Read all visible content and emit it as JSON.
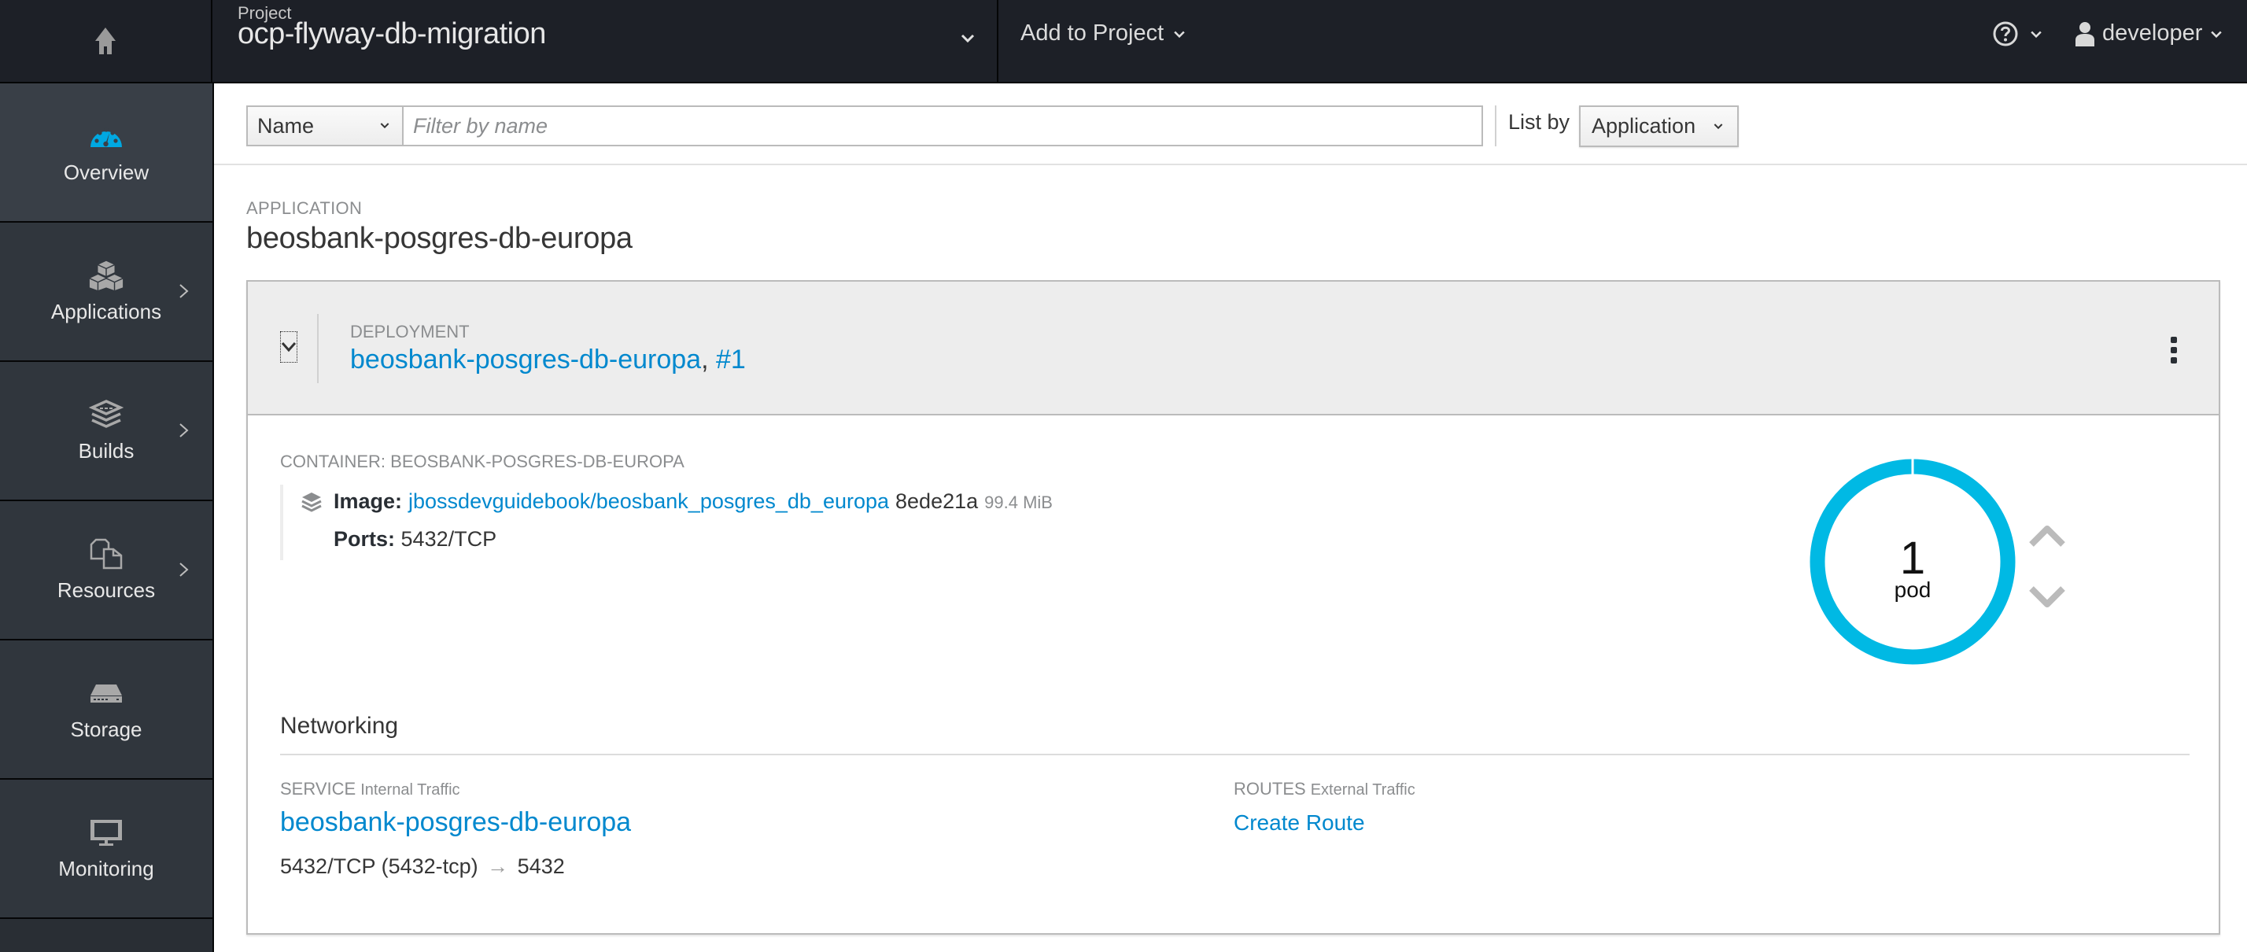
{
  "header": {
    "home_icon": "home-icon",
    "project_label": "Project",
    "project_name": "ocp-flyway-db-migration",
    "add_to_project": "Add to Project",
    "help_icon": "question-circle-icon",
    "user_icon": "user-icon",
    "username": "developer"
  },
  "sidebar": {
    "items": [
      {
        "label": "Overview",
        "icon": "dashboard-icon",
        "active": true,
        "has_submenu": false
      },
      {
        "label": "Applications",
        "icon": "cubes-icon",
        "active": false,
        "has_submenu": true
      },
      {
        "label": "Builds",
        "icon": "layers-icon",
        "active": false,
        "has_submenu": true
      },
      {
        "label": "Resources",
        "icon": "files-icon",
        "active": false,
        "has_submenu": true
      },
      {
        "label": "Storage",
        "icon": "storage-icon",
        "active": false,
        "has_submenu": false
      },
      {
        "label": "Monitoring",
        "icon": "monitor-icon",
        "active": false,
        "has_submenu": false
      }
    ]
  },
  "toolbar": {
    "filter_type": "Name",
    "filter_placeholder": "Filter by name",
    "filter_value": "",
    "list_by_label": "List by",
    "list_by_value": "Application"
  },
  "application": {
    "kicker": "APPLICATION",
    "name": "beosbank-posgres-db-europa"
  },
  "deployment": {
    "kicker": "DEPLOYMENT",
    "name": "beosbank-posgres-db-europa",
    "separator": ",",
    "revision": "#1",
    "container": {
      "kicker": "CONTAINER: BEOSBANK-POSGRES-DB-EUROPA",
      "image_label": "Image:",
      "image_name": "jbossdevguidebook/beosbank_posgres_db_europa",
      "image_id": "8ede21a",
      "image_size": "99.4 MiB",
      "ports_label": "Ports:",
      "ports_value": "5432/TCP"
    },
    "pods": {
      "count": "1",
      "label": "pod",
      "ring_color": "#00b9e4",
      "running_fraction": 1.0
    }
  },
  "networking": {
    "title": "Networking",
    "service": {
      "kicker": "SERVICE",
      "sub": "Internal Traffic",
      "name": "beosbank-posgres-db-europa",
      "port_mapping": "5432/TCP (5432-tcp)",
      "arrow": "→",
      "target_port": "5432"
    },
    "routes": {
      "kicker": "ROUTES",
      "sub": "External Traffic",
      "create_label": "Create Route"
    }
  },
  "colors": {
    "masthead": "#1d2027",
    "sidebar": "#30363d",
    "sidebar_active": "#393f47",
    "link": "#0088ce",
    "accent": "#00b9e4"
  }
}
